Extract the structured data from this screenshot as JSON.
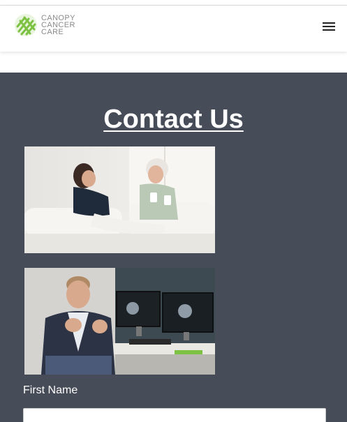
{
  "brand": {
    "logo_lines": [
      "CANOPY",
      "CANCER",
      "CARE"
    ],
    "logo_color": "#8a8a8a",
    "accent_green": "#7dc242"
  },
  "header": {
    "menu_icon": "hamburger-menu-icon"
  },
  "main": {
    "background": "#474c59",
    "title": "Contact Us",
    "images": [
      {
        "icon": "photo-two-women-on-sofa"
      },
      {
        "icon": "photo-man-at-computer-desk"
      }
    ],
    "form": {
      "first_name_label": "First Name",
      "first_name_value": ""
    }
  }
}
